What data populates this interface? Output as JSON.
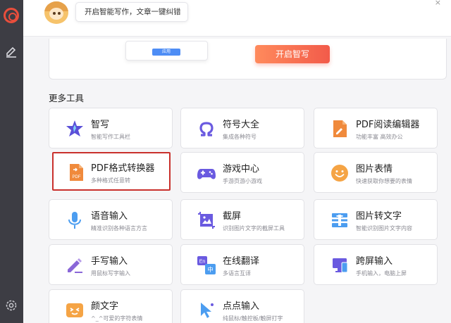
{
  "header": {
    "prompt_text": "开启智能写作，文章一键纠错",
    "close_glyph": "×"
  },
  "banner": {
    "mini_button_label": "应用",
    "start_button_label": "开启智写"
  },
  "section_title": "更多工具",
  "tools": [
    {
      "id": "smart-write",
      "title": "智写",
      "subtitle": "智能写作工具栏"
    },
    {
      "id": "symbols",
      "title": "符号大全",
      "subtitle": "集成各种符号"
    },
    {
      "id": "pdf-editor",
      "title": "PDF阅读编辑器",
      "subtitle": "功能丰富 高效办公"
    },
    {
      "id": "pdf-converter",
      "title": "PDF格式转换器",
      "subtitle": "多种格式任意转"
    },
    {
      "id": "game-center",
      "title": "游戏中心",
      "subtitle": "手游页游小游戏"
    },
    {
      "id": "emoji-pic",
      "title": "图片表情",
      "subtitle": "快速获取你想要的表情"
    },
    {
      "id": "voice-input",
      "title": "语音输入",
      "subtitle": "精准识别各种语言方言"
    },
    {
      "id": "screenshot",
      "title": "截屏",
      "subtitle": "识别图片文字的截屏工具"
    },
    {
      "id": "img-to-text",
      "title": "图片转文字",
      "subtitle": "智能识别图片文字内容"
    },
    {
      "id": "handwrite",
      "title": "手写输入",
      "subtitle": "用鼠标写字输入"
    },
    {
      "id": "translate",
      "title": "在线翻译",
      "subtitle": "多语言互译"
    },
    {
      "id": "cross-screen",
      "title": "跨屏输入",
      "subtitle": "手机输入，电脑上屏"
    },
    {
      "id": "kaomoji",
      "title": "颜文字",
      "subtitle": "^_^可爱的字符表情"
    },
    {
      "id": "dot-input",
      "title": "点点输入",
      "subtitle": "纯鼠标/触控板/触屏打字"
    }
  ],
  "icon_text": {
    "pdf": "PDF",
    "translate_en": "En",
    "translate_zh": "中"
  },
  "colors": {
    "sidebar": "#3d3d44",
    "accent_red": "#e94e3c",
    "start_button": "#f25b4a",
    "highlight_border": "#c9302c",
    "icon_purple": "#6a5ae0",
    "icon_orange": "#f08a3c"
  }
}
